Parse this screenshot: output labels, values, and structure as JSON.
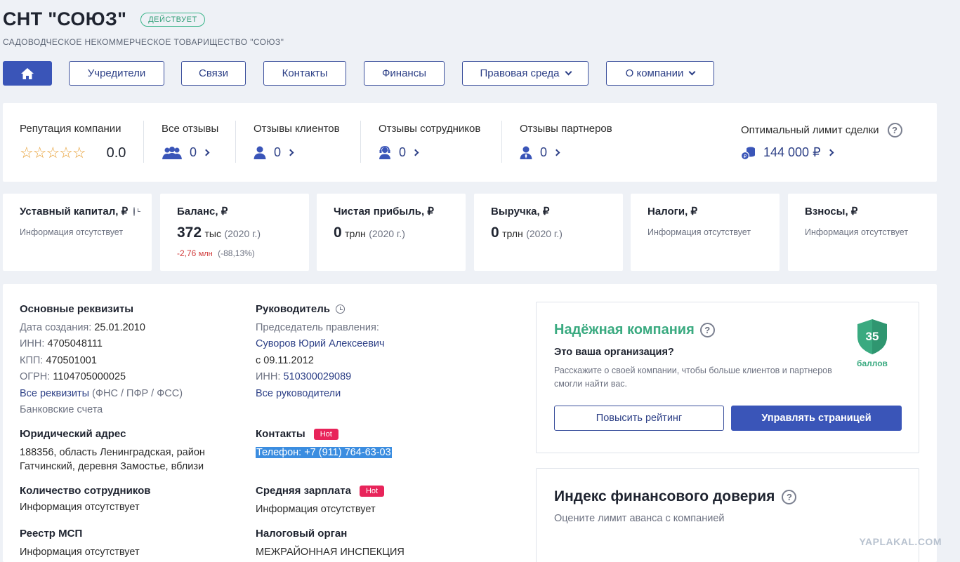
{
  "header": {
    "title": "СНТ \"СОЮЗ\"",
    "status": "ДЕЙСТВУЕТ",
    "full_name": "САДОВОДЧЕСКОЕ НЕКОММЕРЧЕСКОЕ ТОВАРИЩЕСТВО \"СОЮЗ\""
  },
  "nav": {
    "home_icon": "home-icon",
    "items": [
      "Учредители",
      "Связи",
      "Контакты",
      "Финансы",
      "Правовая среда",
      "О компании"
    ]
  },
  "reputation": {
    "label": "Репутация компании",
    "stars": "☆☆☆☆☆",
    "score": "0.0",
    "all_reviews": {
      "label": "Все отзывы",
      "count": "0"
    },
    "client_reviews": {
      "label": "Отзывы клиентов",
      "count": "0"
    },
    "employee_reviews": {
      "label": "Отзывы сотрудников",
      "count": "0"
    },
    "partner_reviews": {
      "label": "Отзывы партнеров",
      "count": "0"
    },
    "deal_limit": {
      "label": "Оптимальный лимит сделки",
      "value": "144 000 ₽"
    }
  },
  "finance": {
    "capital": {
      "title": "Уставный капитал, ₽",
      "text": "Информация отсутствует"
    },
    "balance": {
      "title": "Баланс, ₽",
      "value": "372",
      "unit": "тыс",
      "year": "(2020 г.)",
      "delta": "-2,76",
      "delta_unit": "млн",
      "pct": "(-88,13%)"
    },
    "profit": {
      "title": "Чистая прибыль, ₽",
      "value": "0",
      "unit": "трлн",
      "year": "(2020 г.)"
    },
    "revenue": {
      "title": "Выручка, ₽",
      "value": "0",
      "unit": "трлн",
      "year": "(2020 г.)"
    },
    "taxes": {
      "title": "Налоги, ₽",
      "text": "Информация отсутствует"
    },
    "contributions": {
      "title": "Взносы, ₽",
      "text": "Информация отсутствует"
    }
  },
  "details": {
    "title": "Основные реквизиты",
    "created_label": "Дата создания:",
    "created": "25.01.2010",
    "inn_label": "ИНН:",
    "inn": "4705048111",
    "kpp_label": "КПП:",
    "kpp": "470501001",
    "ogrn_label": "ОГРН:",
    "ogrn": "1104705000025",
    "all_link": "Все реквизиты",
    "all_sources": "(ФНС / ПФР / ФСС)",
    "bank": "Банковские счета"
  },
  "address": {
    "title": "Юридический адрес",
    "line1": "188356, область Ленинградская, район",
    "line2": "Гатчинский, деревня Замостье, вблизи"
  },
  "employees": {
    "title": "Количество сотрудников",
    "text": "Информация отсутствует"
  },
  "msp": {
    "title": "Реестр МСП",
    "text": "Информация отсутствует"
  },
  "head": {
    "title": "Руководитель",
    "position": "Председатель правления:",
    "name": "Суворов Юрий Алексеевич",
    "since": "с 09.11.2012",
    "inn_label": "ИНН:",
    "inn": "510300029089",
    "all_link": "Все руководители"
  },
  "contacts": {
    "title": "Контакты",
    "hot": "Hot",
    "phone": "Телефон: +7 (911) 764-63-03"
  },
  "salary": {
    "title": "Средняя зарплата",
    "hot": "Hot",
    "text": "Информация отсутствует"
  },
  "tax_office": {
    "title": "Налоговый орган",
    "text": "МЕЖРАЙОННАЯ ИНСПЕКЦИЯ"
  },
  "trust": {
    "title": "Надёжная компания",
    "question": "Это ваша организация?",
    "desc": "Расскажите о своей компании, чтобы больше клиентов и партнеров смогли найти вас.",
    "score": "35",
    "points_label": "баллов",
    "btn_rating": "Повысить рейтинг",
    "btn_manage": "Управлять страницей"
  },
  "index": {
    "title": "Индекс финансового доверия",
    "desc": "Оцените лимит аванса с компанией"
  },
  "watermark": "YAPLAKAL.COM",
  "colors": {
    "accent": "#3a55b8",
    "green": "#3aaa80",
    "hot": "#e8245a",
    "negative": "#d03b3b"
  }
}
